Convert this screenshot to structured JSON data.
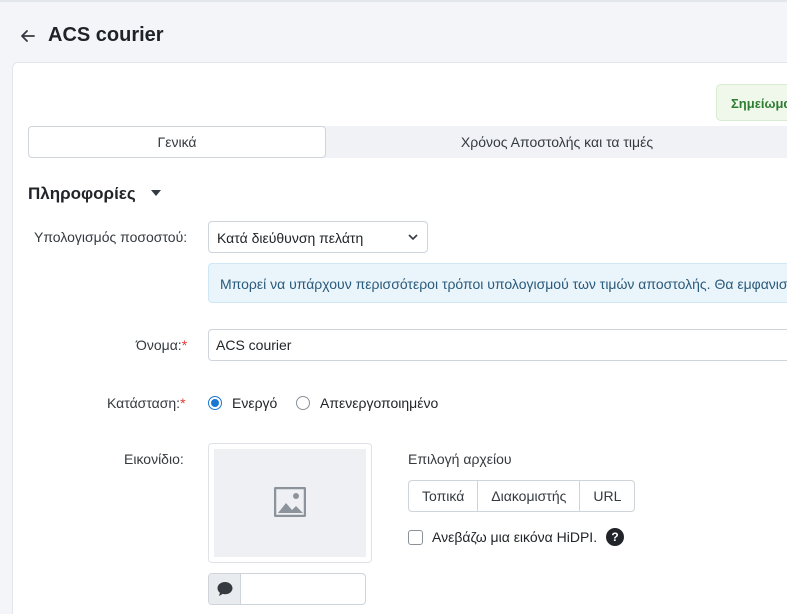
{
  "header": {
    "title": "ACS courier"
  },
  "note_badge": {
    "text": "Σημείωμα"
  },
  "tabs": [
    {
      "label": "Γενικά",
      "active": true
    },
    {
      "label": "Χρόνος Αποστολής και τα τιμές",
      "active": false
    }
  ],
  "section": {
    "title": "Πληροφορίες"
  },
  "form": {
    "rate_calc": {
      "label": "Υπολογισμός ποσοστού:",
      "value": "Κατά διεύθυνση πελάτη",
      "info": "Μπορεί να υπάρχουν περισσότεροι τρόποι υπολογισμού των τιμών αποστολής. Θα εμφανιστεί"
    },
    "name": {
      "label": "Όνομα:",
      "required": "*",
      "value": "ACS courier"
    },
    "status": {
      "label": "Κατάσταση:",
      "required": "*",
      "options": [
        "Ενεργό",
        "Απενεργοποιημένο"
      ],
      "selected": "Ενεργό"
    },
    "icon": {
      "label": "Εικονίδιο:",
      "file_label": "Επιλογή αρχείου",
      "sources": [
        "Τοπικά",
        "Διακομιστής",
        "URL"
      ],
      "hidpi_label": "Ανεβάζω μια εικόνα HiDPI.",
      "help": "?",
      "alt_value": ""
    }
  },
  "colors": {
    "accent": "#1976d2",
    "required": "#e53935",
    "note_green": "#2e7d32"
  }
}
